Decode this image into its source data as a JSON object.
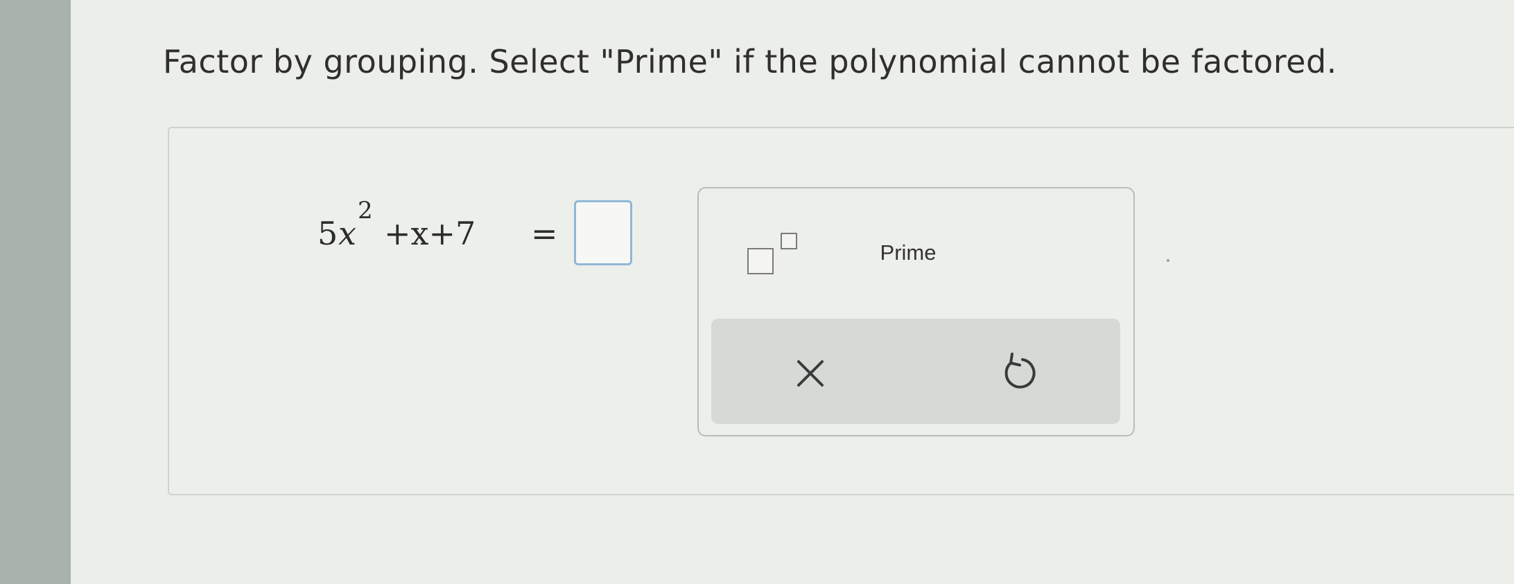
{
  "question": {
    "instruction": "Factor by grouping. Select \"Prime\" if the polynomial cannot be factored."
  },
  "equation": {
    "coefficient": "5",
    "variable": "x",
    "exponent": "2",
    "rest": "+x+7",
    "equals": "="
  },
  "answer": {
    "value": ""
  },
  "palette": {
    "exponent_template_icon": "superscript-template-icon",
    "prime_label": "Prime",
    "clear_icon": "times-icon",
    "undo_icon": "undo-icon"
  },
  "colors": {
    "answer_box_border": "#8fb7d6",
    "action_bar": "#d6dad6"
  }
}
